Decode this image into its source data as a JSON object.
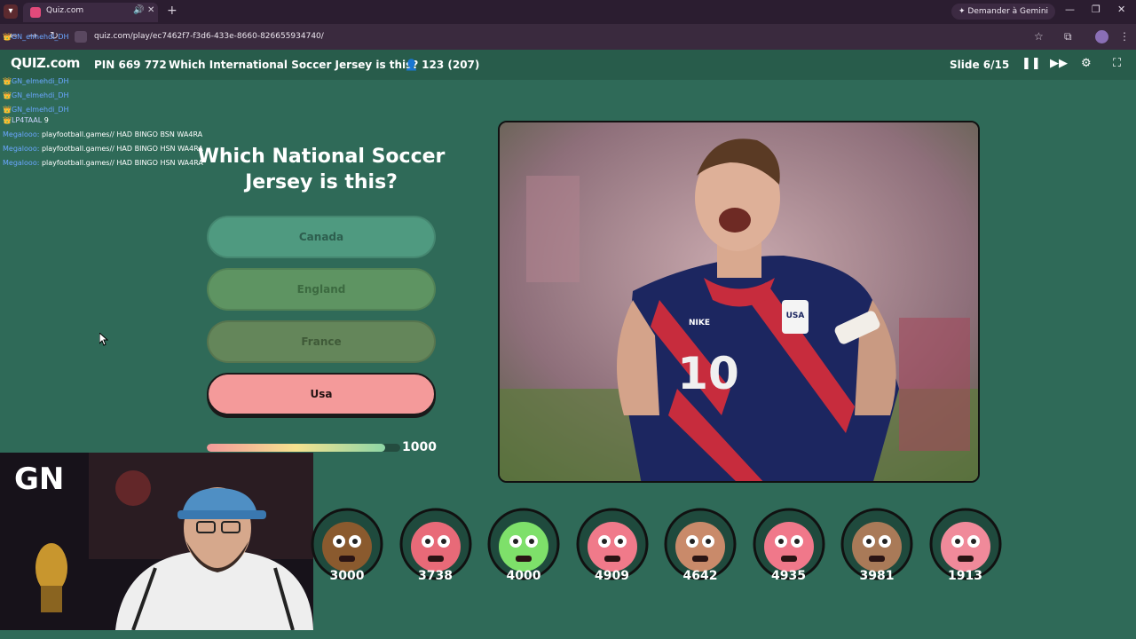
{
  "browser": {
    "tab_title": "Quiz.com",
    "url": "quiz.com/play/ec7462f7-f3d6-433e-8660-826655934740/",
    "gemini_label": "Demander à Gemini"
  },
  "header": {
    "logo": "QUIZ.com",
    "pin": "PIN 669 772",
    "title": "Which International Soccer Jersey is this?",
    "players": "123 (207)",
    "slide": "Slide 6/15"
  },
  "chat": [
    {
      "name": "Megalooo:",
      "text": "playfootball.games// HAD BINGO BSN WA4RA"
    },
    {
      "name": "Megalooo:",
      "text": "playfootball.games// HAD BINGO HSN WA4RA"
    },
    {
      "name": "Megalooo:",
      "text": "playfootball.games// HAD BINGO HSN WA4RA"
    }
  ],
  "chat_names": [
    "GN_elmehdi_DH",
    "GN_elmehdi_DH",
    "GN_elmehdi_DH",
    "GN_elmehdi_DH",
    "LP4TAAL"
  ],
  "chat_extra": "9",
  "question": {
    "text": "Which National Soccer Jersey is this?",
    "answers": [
      "Canada",
      "England",
      "France",
      "Usa"
    ],
    "timer_value": "1000",
    "timer_fraction": 0.92
  },
  "photo": {
    "jersey_number": "10",
    "crest_text": "USA",
    "brand_text": "NIKE"
  },
  "webcam": {
    "logo": "GN"
  },
  "players_scores": [
    "3000",
    "3738",
    "4000",
    "4909",
    "4642",
    "4935",
    "3981",
    "1913"
  ],
  "colors": {
    "background": "#2f6a58",
    "selected_answer": "#f49a9a"
  }
}
